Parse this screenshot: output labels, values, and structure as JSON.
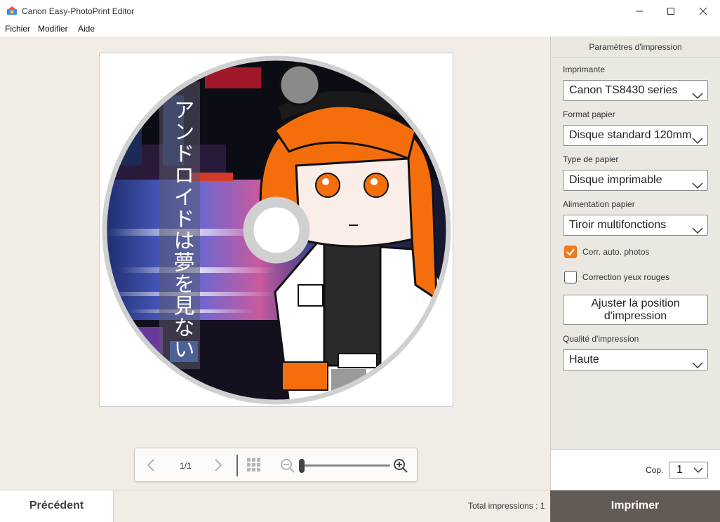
{
  "window": {
    "title": "Canon Easy-PhotoPrint Editor",
    "controls": [
      "minimize-icon",
      "maximize-icon",
      "close-icon"
    ]
  },
  "menu": {
    "items": [
      "Fichier",
      "Modifier",
      "Aide"
    ]
  },
  "disc": {
    "vertical_text": "アンドロイドは夢を見ない",
    "ring_color": "#d0d0d0",
    "accent_orange": "#f46f0c"
  },
  "navigation": {
    "page_indicator": "1/1",
    "zoom_level": 0.0,
    "icons": [
      "chevron-left-icon",
      "chevron-right-icon",
      "grid-view-icon",
      "zoom-out-icon",
      "zoom-in-icon"
    ]
  },
  "panel": {
    "header": "Paramètres d'impression",
    "printer": {
      "label": "Imprimante",
      "value": "Canon TS8430 series"
    },
    "paper_size": {
      "label": "Format papier",
      "value": "Disque standard 120mm"
    },
    "paper_type": {
      "label": "Type de papier",
      "value": "Disque imprimable"
    },
    "paper_source": {
      "label": "Alimentation papier",
      "value": "Tiroir multifonctions"
    },
    "auto_correct": {
      "label": "Corr. auto. photos",
      "checked": true
    },
    "red_eye": {
      "label": "Correction yeux rouges",
      "checked": false
    },
    "adjust_button_line1": "Ajuster la position",
    "adjust_button_line2": "d'impression",
    "quality": {
      "label": "Qualité d'impression",
      "value": "Haute"
    },
    "copies": {
      "label": "Cop.",
      "value": "1"
    }
  },
  "footer": {
    "previous_label": "Précédent",
    "total_label": "Total impressions : 1",
    "print_label": "Imprimer"
  },
  "colors": {
    "accent": "#f07c21",
    "print_button": "#625a54",
    "background": "#f1ede6"
  }
}
